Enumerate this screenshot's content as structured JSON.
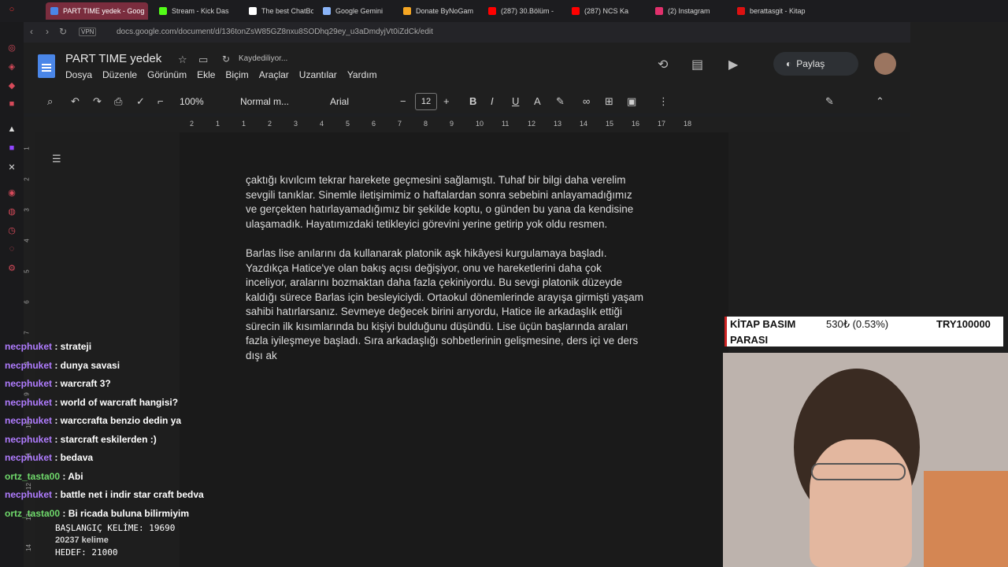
{
  "browser": {
    "tabs": [
      {
        "label": "PART TIME yedek - Goog",
        "color": "#4a86e8"
      },
      {
        "label": "Stream - Kick Das",
        "color": "#53fc18"
      },
      {
        "label": "The best ChatBot",
        "color": "#ffffff"
      },
      {
        "label": "Google Gemini",
        "color": "#8ab4f8"
      },
      {
        "label": "Donate ByNoGam",
        "color": "#f5a623"
      },
      {
        "label": "(287) 30.Bölüm -",
        "color": "#ff0000"
      },
      {
        "label": "(287) NCS Ka",
        "color": "#ff0000"
      },
      {
        "label": "(2) Instagram",
        "color": "#e1306c"
      },
      {
        "label": "berattasgit - Kitap",
        "color": "#d11"
      }
    ],
    "vpn_label": "VPN",
    "url": "docs.google.com/document/d/136tonZsW85GZ8nxu8SODhq29ey_u3aDmdyjVt0iZdCk/edit"
  },
  "docs": {
    "title": "PART TIME  yedek",
    "saving": "Kaydediliyor...",
    "menu": [
      "Dosya",
      "Düzenle",
      "Görünüm",
      "Ekle",
      "Biçim",
      "Araçlar",
      "Uzantılar",
      "Yardım"
    ],
    "share_label": "Paylaş",
    "toolbar": {
      "zoom": "100%",
      "style": "Normal m...",
      "font": "Arial",
      "size": "12"
    },
    "ruler": [
      "2",
      "1",
      "1",
      "2",
      "3",
      "4",
      "5",
      "6",
      "7",
      "8",
      "9",
      "10",
      "11",
      "12",
      "13",
      "14",
      "15",
      "16",
      "17",
      "18"
    ],
    "vruler": [
      "1",
      "2",
      "3",
      "4",
      "5",
      "6",
      "7",
      "8",
      "9",
      "10",
      "11",
      "12",
      "13",
      "14"
    ],
    "paragraphs": [
      "çaktığı kıvılcım tekrar harekete geçmesini sağlamıştı. Tuhaf bir bilgi daha verelim\nsevgili tanıklar. Sinemle iletişimimiz o haftalardan sonra sebebini anlayamadığımız\nve gerçekten hatırlayamadığımız bir şekilde koptu, o günden bu yana da kendisine\nulaşamadık. Hayatımızdaki tetikleyici görevini yerine getirip yok oldu resmen.",
      "Barlas lise anılarını da kullanarak platonik aşk hikâyesi kurgulamaya başladı.\nYazdıkça Hatice'ye olan bakış açısı değişiyor, onu ve hareketlerini daha çok\ninceliyor, aralarını bozmaktan daha fazla çekiniyordu. Bu sevgi platonik düzeyde\nkaldığı sürece Barlas için besleyiciydi. Ortaokul dönemlerinde arayışa girmişti yaşam\nsahibi hatırlarsanız. Sevmeye değecek birini arıyordu, Hatice ile arkadaşlık ettiği\nsürecin ilk kısımlarında bu kişiyi bulduğunu düşündü. Lise üçün başlarında araları\nfazla iyileşmeye başladı. Sıra arkadaşlığı sohbetlerinin gelişmesine, ders içi ve ders\ndışı ak"
    ]
  },
  "chat": [
    {
      "user": "necphuket",
      "msg": " : strateji"
    },
    {
      "user": "necphuket",
      "msg": " : dunya savasi"
    },
    {
      "user": "necphuket",
      "msg": " : warcraft 3?"
    },
    {
      "user": "necphuket",
      "msg": " : world of warcraft hangisi?"
    },
    {
      "user": "necphuket",
      "msg": " : warccrafta benzio dedin ya"
    },
    {
      "user": "necphuket",
      "msg": " : starcraft eskilerden :)"
    },
    {
      "user": "necphuket",
      "msg": " : bedava"
    },
    {
      "user": "ortz_tasta00",
      "msg": " : Abi"
    },
    {
      "user": "necphuket",
      "msg": " : battle net i indir star craft bedva"
    },
    {
      "user": "ortz_tasta00",
      "msg": " : Bi ricada bulunа bilirmiyim"
    }
  ],
  "stats": {
    "start": "BAŞLANGIÇ KELİME: 19690",
    "count": "20237 kelime",
    "target": "HEDEF: 21000"
  },
  "ticker": {
    "label1": "KİTAP BASIM",
    "label2": "PARASI",
    "value": "530₺ (0.53%)",
    "goal": "TRY100000"
  }
}
